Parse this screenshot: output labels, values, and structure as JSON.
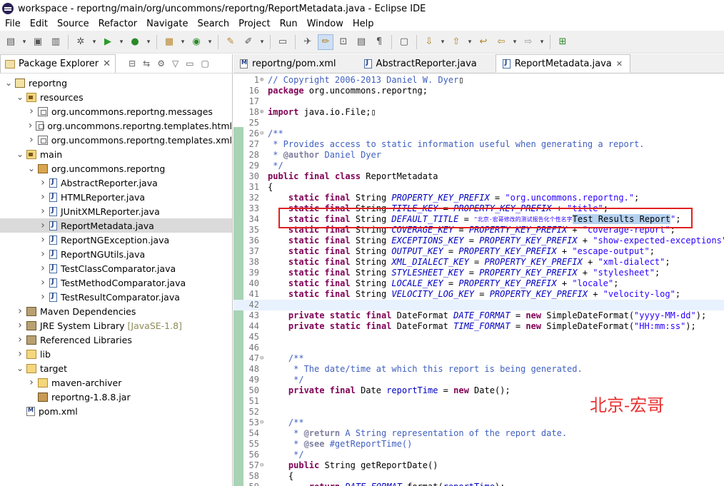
{
  "window": {
    "title": "workspace - reportng/main/org/uncommons/reportng/ReportMetadata.java - Eclipse IDE"
  },
  "menu": [
    "File",
    "Edit",
    "Source",
    "Refactor",
    "Navigate",
    "Search",
    "Project",
    "Run",
    "Window",
    "Help"
  ],
  "explorer": {
    "title": "Package Explorer",
    "tree": [
      {
        "label": "reportng",
        "icon": "project",
        "depth": 0,
        "twisty": "v"
      },
      {
        "label": "resources",
        "icon": "srcfolder",
        "depth": 1,
        "twisty": "v"
      },
      {
        "label": "org.uncommons.reportng.messages",
        "icon": "package",
        "depth": 2,
        "twisty": ">"
      },
      {
        "label": "org.uncommons.reportng.templates.html",
        "icon": "package",
        "depth": 2,
        "twisty": ">"
      },
      {
        "label": "org.uncommons.reportng.templates.xml",
        "icon": "package",
        "depth": 2,
        "twisty": ">"
      },
      {
        "label": "main",
        "icon": "srcfolder",
        "depth": 1,
        "twisty": "v"
      },
      {
        "label": "org.uncommons.reportng",
        "icon": "pkgb",
        "depth": 2,
        "twisty": "v"
      },
      {
        "label": "AbstractReporter.java",
        "icon": "java",
        "depth": 3,
        "twisty": ">"
      },
      {
        "label": "HTMLReporter.java",
        "icon": "java",
        "depth": 3,
        "twisty": ">"
      },
      {
        "label": "JUnitXMLReporter.java",
        "icon": "java",
        "depth": 3,
        "twisty": ">"
      },
      {
        "label": "ReportMetadata.java",
        "icon": "java",
        "depth": 3,
        "twisty": ">",
        "selected": true
      },
      {
        "label": "ReportNGException.java",
        "icon": "java",
        "depth": 3,
        "twisty": ">"
      },
      {
        "label": "ReportNGUtils.java",
        "icon": "java",
        "depth": 3,
        "twisty": ">"
      },
      {
        "label": "TestClassComparator.java",
        "icon": "java",
        "depth": 3,
        "twisty": ">"
      },
      {
        "label": "TestMethodComparator.java",
        "icon": "java",
        "depth": 3,
        "twisty": ">"
      },
      {
        "label": "TestResultComparator.java",
        "icon": "java",
        "depth": 3,
        "twisty": ">"
      },
      {
        "label": "Maven Dependencies",
        "icon": "lib",
        "depth": 1,
        "twisty": ">"
      },
      {
        "label": "JRE System Library",
        "decor": "[JavaSE-1.8]",
        "icon": "lib",
        "depth": 1,
        "twisty": ">"
      },
      {
        "label": "Referenced Libraries",
        "icon": "lib",
        "depth": 1,
        "twisty": ">"
      },
      {
        "label": "lib",
        "icon": "folder",
        "depth": 1,
        "twisty": ">"
      },
      {
        "label": "target",
        "icon": "folder",
        "depth": 1,
        "twisty": "v"
      },
      {
        "label": "maven-archiver",
        "icon": "folder",
        "depth": 2,
        "twisty": ">"
      },
      {
        "label": "reportng-1.8.8.jar",
        "icon": "jar",
        "depth": 2,
        "twisty": ""
      },
      {
        "label": "pom.xml",
        "icon": "xml",
        "depth": 1,
        "twisty": ""
      }
    ]
  },
  "editor": {
    "tabs": [
      {
        "label": "reportng/pom.xml",
        "icon": "m"
      },
      {
        "label": "AbstractReporter.java",
        "icon": "java"
      },
      {
        "label": "ReportMetadata.java",
        "icon": "java",
        "active": true,
        "close": "✕"
      }
    ],
    "lines": [
      {
        "n": "1",
        "fold": "⊕",
        "parts": [
          [
            "cm",
            "// Copyright 2006-2013 Daniel W. Dyer"
          ],
          [
            "",
            "▯"
          ]
        ]
      },
      {
        "n": "16",
        "parts": [
          [
            "kw",
            "package"
          ],
          [
            "",
            " org.uncommons.reportng;"
          ]
        ]
      },
      {
        "n": "17",
        "parts": []
      },
      {
        "n": "18",
        "fold": "⊕",
        "parts": [
          [
            "kw",
            "import"
          ],
          [
            "",
            " java.io.File;▯"
          ]
        ]
      },
      {
        "n": "25",
        "parts": []
      },
      {
        "n": "26",
        "fold": "⊖",
        "parts": [
          [
            "cm",
            "/**"
          ]
        ]
      },
      {
        "n": "27",
        "parts": [
          [
            "cm",
            " * Provides access to static information useful when generating a report."
          ]
        ]
      },
      {
        "n": "28",
        "parts": [
          [
            "cm",
            " * "
          ],
          [
            "ann",
            "@author"
          ],
          [
            "cm",
            " Daniel Dyer"
          ]
        ]
      },
      {
        "n": "29",
        "parts": [
          [
            "cm",
            " */"
          ]
        ]
      },
      {
        "n": "30",
        "parts": [
          [
            "kw",
            "public"
          ],
          [
            "",
            " "
          ],
          [
            "kw",
            "final"
          ],
          [
            "",
            " "
          ],
          [
            "kw",
            "class"
          ],
          [
            "",
            " ReportMetadata"
          ]
        ]
      },
      {
        "n": "31",
        "parts": [
          [
            "",
            "{"
          ]
        ]
      },
      {
        "n": "32",
        "parts": [
          [
            "",
            "    "
          ],
          [
            "kw",
            "static"
          ],
          [
            "",
            " "
          ],
          [
            "kw",
            "final"
          ],
          [
            "",
            " String "
          ],
          [
            "fld",
            "PROPERTY_KEY_PREFIX"
          ],
          [
            "",
            " = "
          ],
          [
            "str",
            "\"org.uncommons.reportng.\""
          ],
          [
            "",
            ";"
          ]
        ]
      },
      {
        "n": "33",
        "parts": [
          [
            "",
            "    "
          ],
          [
            "kw",
            "static"
          ],
          [
            "",
            " "
          ],
          [
            "kw",
            "final"
          ],
          [
            "",
            " String "
          ],
          [
            "fld",
            "TITLE_KEY"
          ],
          [
            "",
            " = "
          ],
          [
            "fld",
            "PROPERTY_KEY_PREFIX"
          ],
          [
            "",
            " + "
          ],
          [
            "str",
            "\"title\""
          ],
          [
            "",
            ";"
          ]
        ]
      },
      {
        "n": "34",
        "parts": [
          [
            "",
            "    "
          ],
          [
            "kw",
            "static"
          ],
          [
            "",
            " "
          ],
          [
            "kw",
            "final"
          ],
          [
            "",
            " String "
          ],
          [
            "fld",
            "DEFAULT_TITLE"
          ],
          [
            "",
            " = "
          ],
          [
            "str",
            "\"北京-宏哥修改的测试报告化个性名字"
          ],
          [
            "sel",
            "Test Results Report"
          ],
          [
            "str",
            "\""
          ],
          [
            "",
            ";"
          ]
        ]
      },
      {
        "n": "35",
        "parts": [
          [
            "",
            "    "
          ],
          [
            "kw",
            "static"
          ],
          [
            "",
            " "
          ],
          [
            "kw",
            "final"
          ],
          [
            "",
            " String "
          ],
          [
            "fld",
            "COVERAGE_KEY"
          ],
          [
            "",
            " = "
          ],
          [
            "fld",
            "PROPERTY_KEY_PREFIX"
          ],
          [
            "",
            " + "
          ],
          [
            "str",
            "\"coverage-report\""
          ],
          [
            "",
            ";"
          ]
        ]
      },
      {
        "n": "36",
        "parts": [
          [
            "",
            "    "
          ],
          [
            "kw",
            "static"
          ],
          [
            "",
            " "
          ],
          [
            "kw",
            "final"
          ],
          [
            "",
            " String "
          ],
          [
            "fld",
            "EXCEPTIONS_KEY"
          ],
          [
            "",
            " = "
          ],
          [
            "fld",
            "PROPERTY_KEY_PREFIX"
          ],
          [
            "",
            " + "
          ],
          [
            "str",
            "\"show-expected-exceptions\""
          ],
          [
            "",
            ";"
          ]
        ]
      },
      {
        "n": "37",
        "parts": [
          [
            "",
            "    "
          ],
          [
            "kw",
            "static"
          ],
          [
            "",
            " "
          ],
          [
            "kw",
            "final"
          ],
          [
            "",
            " String "
          ],
          [
            "fld",
            "OUTPUT_KEY"
          ],
          [
            "",
            " = "
          ],
          [
            "fld",
            "PROPERTY_KEY_PREFIX"
          ],
          [
            "",
            " + "
          ],
          [
            "str",
            "\"escape-output\""
          ],
          [
            "",
            ";"
          ]
        ]
      },
      {
        "n": "38",
        "parts": [
          [
            "",
            "    "
          ],
          [
            "kw",
            "static"
          ],
          [
            "",
            " "
          ],
          [
            "kw",
            "final"
          ],
          [
            "",
            " String "
          ],
          [
            "fld",
            "XML_DIALECT_KEY"
          ],
          [
            "",
            " = "
          ],
          [
            "fld",
            "PROPERTY_KEY_PREFIX"
          ],
          [
            "",
            " + "
          ],
          [
            "str",
            "\"xml-dialect\""
          ],
          [
            "",
            ";"
          ]
        ]
      },
      {
        "n": "39",
        "parts": [
          [
            "",
            "    "
          ],
          [
            "kw",
            "static"
          ],
          [
            "",
            " "
          ],
          [
            "kw",
            "final"
          ],
          [
            "",
            " String "
          ],
          [
            "fld",
            "STYLESHEET_KEY"
          ],
          [
            "",
            " = "
          ],
          [
            "fld",
            "PROPERTY_KEY_PREFIX"
          ],
          [
            "",
            " + "
          ],
          [
            "str",
            "\"stylesheet\""
          ],
          [
            "",
            ";"
          ]
        ]
      },
      {
        "n": "40",
        "parts": [
          [
            "",
            "    "
          ],
          [
            "kw",
            "static"
          ],
          [
            "",
            " "
          ],
          [
            "kw",
            "final"
          ],
          [
            "",
            " String "
          ],
          [
            "fld",
            "LOCALE_KEY"
          ],
          [
            "",
            " = "
          ],
          [
            "fld",
            "PROPERTY_KEY_PREFIX"
          ],
          [
            "",
            " + "
          ],
          [
            "str",
            "\"locale\""
          ],
          [
            "",
            ";"
          ]
        ]
      },
      {
        "n": "41",
        "parts": [
          [
            "",
            "    "
          ],
          [
            "kw",
            "static"
          ],
          [
            "",
            " "
          ],
          [
            "kw",
            "final"
          ],
          [
            "",
            " String "
          ],
          [
            "fld",
            "VELOCITY_LOG_KEY"
          ],
          [
            "",
            " = "
          ],
          [
            "fld",
            "PROPERTY_KEY_PREFIX"
          ],
          [
            "",
            " + "
          ],
          [
            "str",
            "\"velocity-log\""
          ],
          [
            "",
            ";"
          ]
        ]
      },
      {
        "n": "42",
        "current": true,
        "parts": []
      },
      {
        "n": "43",
        "parts": [
          [
            "",
            "    "
          ],
          [
            "kw",
            "private"
          ],
          [
            "",
            " "
          ],
          [
            "kw",
            "static"
          ],
          [
            "",
            " "
          ],
          [
            "kw",
            "final"
          ],
          [
            "",
            " DateFormat "
          ],
          [
            "fld",
            "DATE_FORMAT"
          ],
          [
            "",
            " = "
          ],
          [
            "kw",
            "new"
          ],
          [
            "",
            " SimpleDateFormat("
          ],
          [
            "str",
            "\"yyyy-MM-dd\""
          ],
          [
            "",
            ");"
          ]
        ]
      },
      {
        "n": "44",
        "parts": [
          [
            "",
            "    "
          ],
          [
            "kw",
            "private"
          ],
          [
            "",
            " "
          ],
          [
            "kw",
            "static"
          ],
          [
            "",
            " "
          ],
          [
            "kw",
            "final"
          ],
          [
            "",
            " DateFormat "
          ],
          [
            "fld",
            "TIME_FORMAT"
          ],
          [
            "",
            " = "
          ],
          [
            "kw",
            "new"
          ],
          [
            "",
            " SimpleDateFormat("
          ],
          [
            "str",
            "\"HH:mm:ss\""
          ],
          [
            "",
            ");"
          ]
        ]
      },
      {
        "n": "45",
        "parts": []
      },
      {
        "n": "46",
        "parts": []
      },
      {
        "n": "47",
        "fold": "⊖",
        "parts": [
          [
            "",
            "    "
          ],
          [
            "cm",
            "/**"
          ]
        ]
      },
      {
        "n": "48",
        "parts": [
          [
            "cm",
            "     * The date/time at which this report is being generated."
          ]
        ]
      },
      {
        "n": "49",
        "parts": [
          [
            "cm",
            "     */"
          ]
        ]
      },
      {
        "n": "50",
        "parts": [
          [
            "",
            "    "
          ],
          [
            "kw",
            "private"
          ],
          [
            "",
            " "
          ],
          [
            "kw",
            "final"
          ],
          [
            "",
            " Date "
          ],
          [
            "fld2",
            "reportTime"
          ],
          [
            "",
            " = "
          ],
          [
            "kw",
            "new"
          ],
          [
            "",
            " Date();"
          ]
        ]
      },
      {
        "n": "51",
        "parts": []
      },
      {
        "n": "52",
        "parts": []
      },
      {
        "n": "53",
        "fold": "⊖",
        "parts": [
          [
            "",
            "    "
          ],
          [
            "cm",
            "/**"
          ]
        ]
      },
      {
        "n": "54",
        "parts": [
          [
            "cm",
            "     * "
          ],
          [
            "ann",
            "@return"
          ],
          [
            "cm",
            " A String representation of the report date."
          ]
        ]
      },
      {
        "n": "55",
        "parts": [
          [
            "cm",
            "     * "
          ],
          [
            "ann",
            "@see"
          ],
          [
            "cm",
            " #getReportTime()"
          ]
        ]
      },
      {
        "n": "56",
        "parts": [
          [
            "cm",
            "     */"
          ]
        ]
      },
      {
        "n": "57",
        "fold": "⊖",
        "parts": [
          [
            "",
            "    "
          ],
          [
            "kw",
            "public"
          ],
          [
            "",
            " String getReportDate()"
          ]
        ]
      },
      {
        "n": "58",
        "parts": [
          [
            "",
            "    {"
          ]
        ]
      },
      {
        "n": "59",
        "parts": [
          [
            "",
            "        "
          ],
          [
            "kw",
            "return"
          ],
          [
            "",
            " "
          ],
          [
            "fld",
            "DATE_FORMAT"
          ],
          [
            "",
            ".format("
          ],
          [
            "fld2",
            "reportTime"
          ],
          [
            "",
            ");"
          ]
        ]
      }
    ]
  },
  "watermark": "北京-宏哥",
  "colors": {
    "highlight_box": "#e02020",
    "watermark": "#e83030",
    "keyword": "#7f0055",
    "comment": "#3f5fbf",
    "string": "#2a00ff",
    "field": "#0000c0"
  }
}
